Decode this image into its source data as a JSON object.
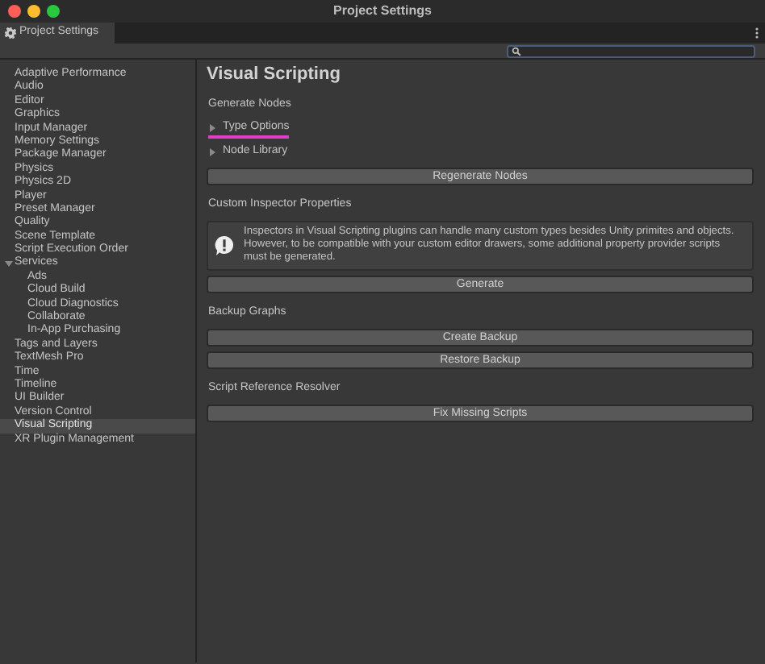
{
  "window": {
    "title": "Project Settings"
  },
  "tabs": [
    {
      "label": "Project Settings",
      "selected": true
    }
  ],
  "sidebar": {
    "items": [
      {
        "label": "Adaptive Performance",
        "selected": false
      },
      {
        "label": "Audio",
        "selected": false
      },
      {
        "label": "Editor",
        "selected": false
      },
      {
        "label": "Graphics",
        "selected": false
      },
      {
        "label": "Input Manager",
        "selected": false
      },
      {
        "label": "Memory Settings",
        "selected": false
      },
      {
        "label": "Package Manager",
        "selected": false
      },
      {
        "label": "Physics",
        "selected": false
      },
      {
        "label": "Physics 2D",
        "selected": false
      },
      {
        "label": "Player",
        "selected": false
      },
      {
        "label": "Preset Manager",
        "selected": false
      },
      {
        "label": "Quality",
        "selected": false
      },
      {
        "label": "Scene Template",
        "selected": false
      },
      {
        "label": "Script Execution Order",
        "selected": false
      },
      {
        "label": "Services",
        "selected": false,
        "expanded": true,
        "children": [
          {
            "label": "Ads",
            "selected": false
          },
          {
            "label": "Cloud Build",
            "selected": false
          },
          {
            "label": "Cloud Diagnostics",
            "selected": false
          },
          {
            "label": "Collaborate",
            "selected": false
          },
          {
            "label": "In-App Purchasing",
            "selected": false
          }
        ]
      },
      {
        "label": "Tags and Layers",
        "selected": false
      },
      {
        "label": "TextMesh Pro",
        "selected": false
      },
      {
        "label": "Time",
        "selected": false
      },
      {
        "label": "Timeline",
        "selected": false
      },
      {
        "label": "UI Builder",
        "selected": false
      },
      {
        "label": "Version Control",
        "selected": false
      },
      {
        "label": "Visual Scripting",
        "selected": true
      },
      {
        "label": "XR Plugin Management",
        "selected": false
      }
    ]
  },
  "content": {
    "title": "Visual Scripting",
    "sections": [
      {
        "heading": "Generate Nodes",
        "items": [
          {
            "kind": "foldout",
            "label": "Type Options",
            "expanded": false,
            "underlined": true
          },
          {
            "kind": "foldout",
            "label": "Node Library",
            "expanded": false,
            "underlined": false
          },
          {
            "kind": "button",
            "label": "Regenerate Nodes"
          }
        ]
      },
      {
        "heading": "Custom Inspector Properties",
        "items": [
          {
            "kind": "helpbox",
            "text": "Inspectors in Visual Scripting plugins can handle many custom types besides Unity primites and objects. However, to be compatible with your custom editor drawers, some additional property provider scripts must be generated."
          },
          {
            "kind": "button",
            "label": "Generate"
          }
        ]
      },
      {
        "heading": "Backup Graphs",
        "items": [
          {
            "kind": "button",
            "label": "Create Backup"
          },
          {
            "kind": "button",
            "label": "Restore Backup"
          }
        ]
      },
      {
        "heading": "Script Reference Resolver",
        "items": [
          {
            "kind": "button",
            "label": "Fix Missing Scripts"
          }
        ]
      }
    ]
  }
}
